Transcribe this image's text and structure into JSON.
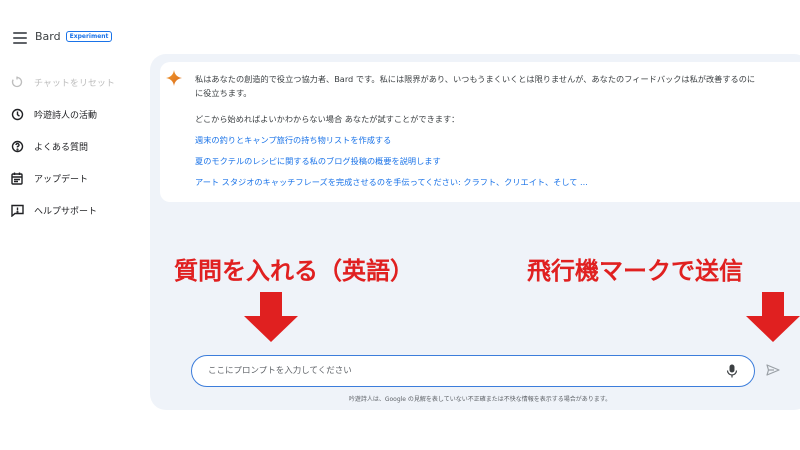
{
  "header": {
    "app_name": "Bard",
    "badge": "Experiment"
  },
  "sidebar": {
    "items": [
      {
        "label": "チャットをリセット",
        "icon": "reset-icon",
        "disabled": true
      },
      {
        "label": "吟遊詩人の活動",
        "icon": "history-icon",
        "disabled": false
      },
      {
        "label": "よくある質問",
        "icon": "help-icon",
        "disabled": false
      },
      {
        "label": "アップデート",
        "icon": "calendar-icon",
        "disabled": false
      },
      {
        "label": "ヘルプサポート",
        "icon": "feedback-icon",
        "disabled": false
      }
    ]
  },
  "main": {
    "intro_line1": "私はあなたの創造的で役立つ協力者、Bard です。私には限界があり、いつもうまくいくとは限りませんが、あなたのフィードバックは私が改善するのに",
    "intro_line2": "に役立ちます。",
    "hint": "どこから始めればよいかわからない場合 あなたが試すことができます：",
    "suggestions": [
      "週末の釣りとキャンプ旅行の持ち物リストを作成する",
      "夏のモクテルのレシピに関する私のブログ投稿の概要を説明します",
      "アート スタジオのキャッチフレーズを完成させるのを手伝ってください: クラフト、クリエイト、そして ..."
    ]
  },
  "annotations": {
    "left": "質問を入れる（英語）",
    "right": "飛行機マークで送信",
    "color": "#e02020"
  },
  "input": {
    "placeholder": "ここにプロンプトを入力してください"
  },
  "disclaimer": "吟遊詩人は、Google の見解を表していない不正確または不快な情報を表示する場合があります。",
  "colors": {
    "accent": "#1a73e8",
    "panel": "#eff3f9",
    "annotation": "#e02020"
  }
}
